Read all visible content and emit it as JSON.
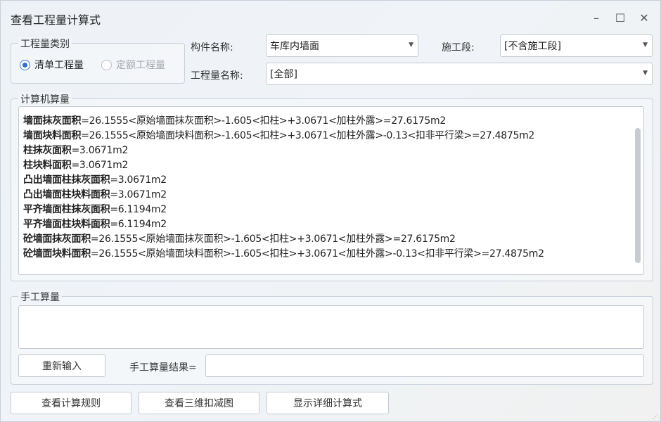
{
  "window": {
    "title": "查看工程量计算式",
    "minimize_glyph": "–",
    "maximize_glyph": "☐",
    "close_glyph": "✕"
  },
  "category": {
    "legend": "工程量类别",
    "option_bill": "清单工程量",
    "option_quota": "定额工程量",
    "selected": "清单工程量"
  },
  "filters": {
    "component_label": "构件名称:",
    "component_value": "车库内墙面",
    "stage_label": "施工段:",
    "stage_value": "[不含施工段]",
    "quantity_label": "工程量名称:",
    "quantity_value": "[全部]"
  },
  "computer_calc": {
    "legend": "计算机算量",
    "lines": [
      {
        "name": "墙面抹灰面积",
        "expr": "=26.1555<原始墙面抹灰面积>-1.605<扣柱>+3.0671<加柱外露>=27.6175m2"
      },
      {
        "name": "墙面块料面积",
        "expr": "=26.1555<原始墙面块料面积>-1.605<扣柱>+3.0671<加柱外露>-0.13<扣非平行梁>=27.4875m2"
      },
      {
        "name": "柱抹灰面积",
        "expr": "=3.0671m2"
      },
      {
        "name": "柱块料面积",
        "expr": "=3.0671m2"
      },
      {
        "name": "凸出墙面柱抹灰面积",
        "expr": "=3.0671m2"
      },
      {
        "name": "凸出墙面柱块料面积",
        "expr": "=3.0671m2"
      },
      {
        "name": "平齐墙面柱抹灰面积",
        "expr": "=6.1194m2"
      },
      {
        "name": "平齐墙面柱块料面积",
        "expr": "=6.1194m2"
      },
      {
        "name": "砼墙面抹灰面积",
        "expr": "=26.1555<原始墙面抹灰面积>-1.605<扣柱>+3.0671<加柱外露>=27.6175m2"
      },
      {
        "name": "砼墙面块料面积",
        "expr": "=26.1555<原始墙面块料面积>-1.605<扣柱>+3.0671<加柱外露>-0.13<扣非平行梁>=27.4875m2"
      }
    ]
  },
  "manual_calc": {
    "legend": "手工算量",
    "reenter_button": "重新输入",
    "result_label": "手工算量结果=",
    "result_value": ""
  },
  "footer": {
    "view_rules_button": "查看计算规则",
    "view_3d_button": "查看三维扣减图",
    "show_detail_button": "显示详细计算式"
  },
  "colors": {
    "accent": "#2f6fd1",
    "border": "#c4cad3",
    "window_bg": "#f0f3f8"
  },
  "icons": {
    "minimize": "minimize-icon",
    "maximize": "maximize-icon",
    "close": "close-icon",
    "dropdown": "chevron-down-icon",
    "resize": "resize-grip-icon"
  }
}
